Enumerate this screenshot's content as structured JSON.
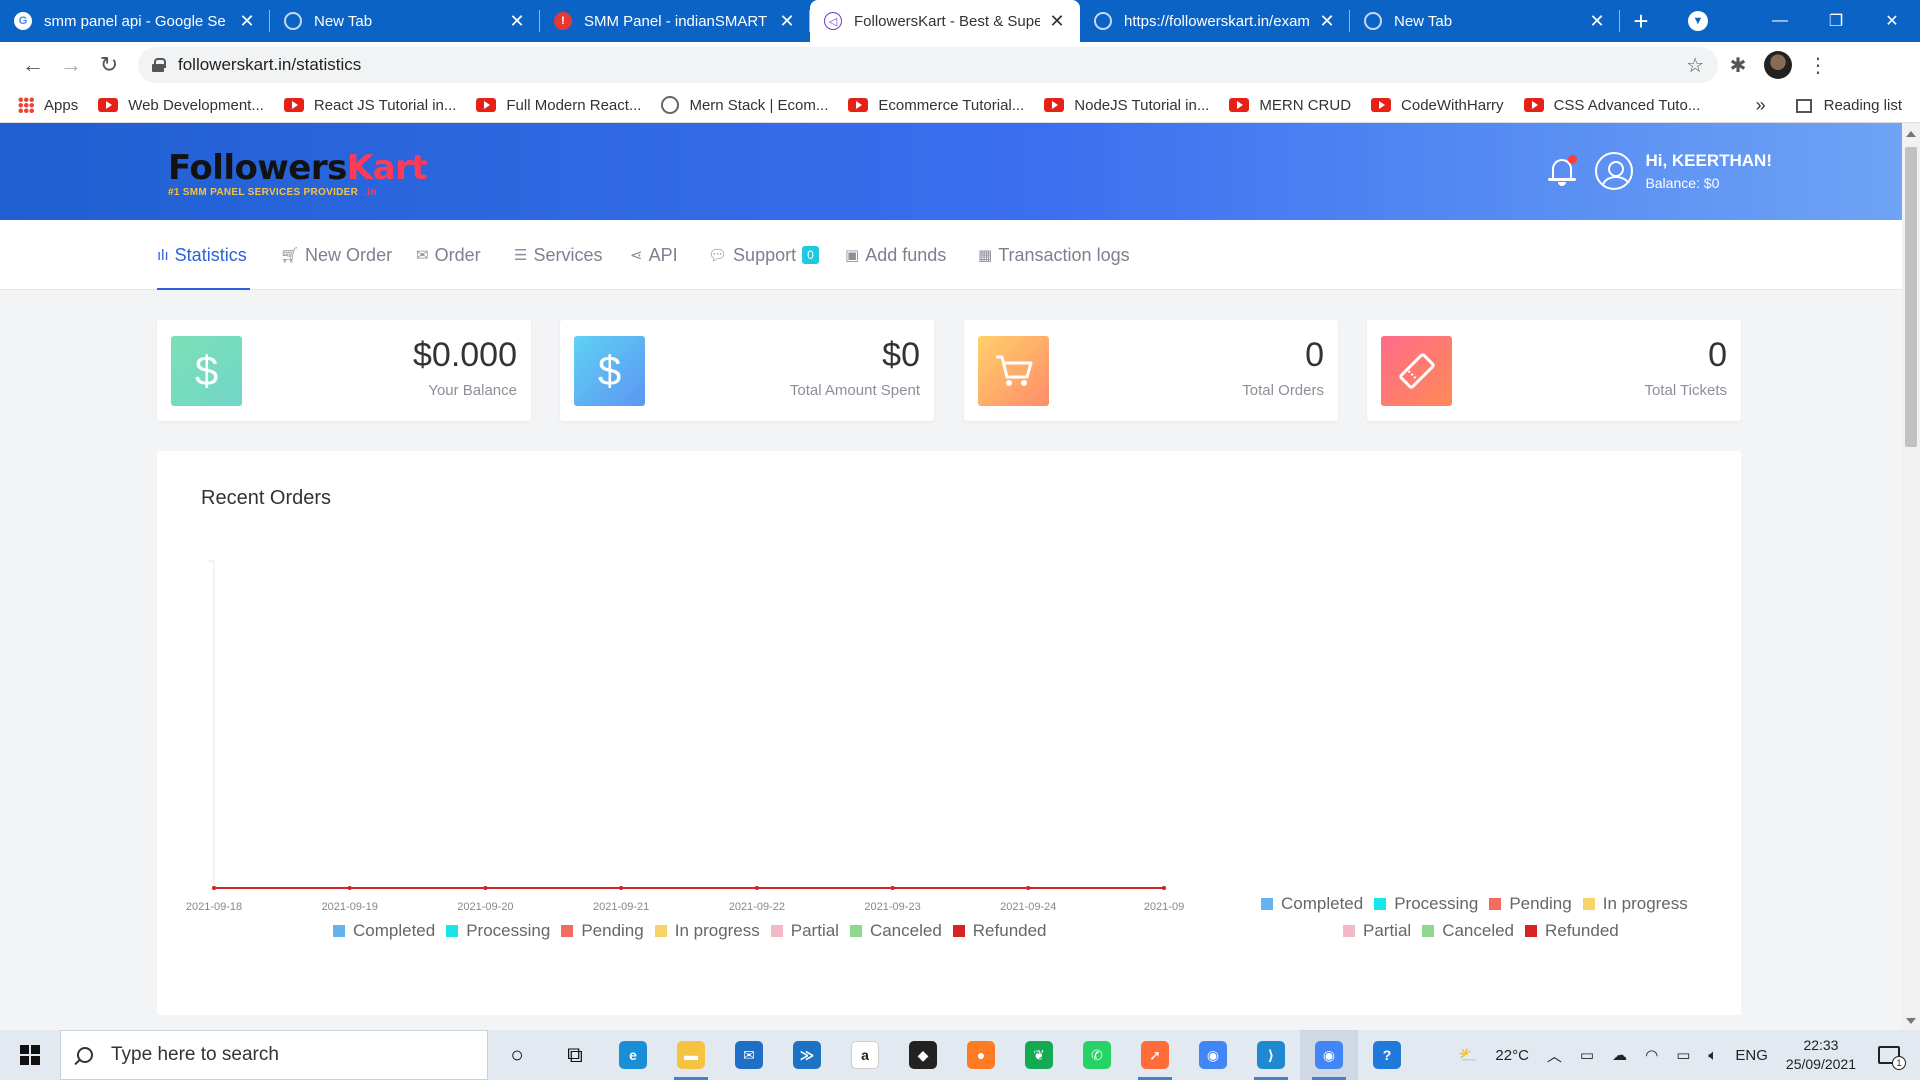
{
  "browser": {
    "tabs": [
      {
        "title": "smm panel api - Google Se",
        "favicon": "google-icon",
        "active": false
      },
      {
        "title": "New Tab",
        "favicon": "chrome-icon",
        "active": false
      },
      {
        "title": "SMM Panel - indianSMART",
        "favicon": "site-red-icon",
        "active": false
      },
      {
        "title": "FollowersKart - Best & Supe",
        "favicon": "followerskart-icon",
        "active": true
      },
      {
        "title": "https://followerskart.in/exam",
        "favicon": "globe-icon",
        "active": false
      },
      {
        "title": "New Tab",
        "favicon": "chrome-icon",
        "active": false
      }
    ],
    "url": "followerskart.in/statistics",
    "bookmarks": [
      {
        "label": "Apps",
        "icon": "apps-grid-icon"
      },
      {
        "label": "Web Development...",
        "icon": "youtube-icon"
      },
      {
        "label": "React JS Tutorial in...",
        "icon": "youtube-icon"
      },
      {
        "label": "Full Modern React...",
        "icon": "youtube-icon"
      },
      {
        "label": "Mern Stack | Ecom...",
        "icon": "globe-icon"
      },
      {
        "label": "Ecommerce Tutorial...",
        "icon": "youtube-icon"
      },
      {
        "label": "NodeJS Tutorial in...",
        "icon": "youtube-icon"
      },
      {
        "label": "MERN CRUD",
        "icon": "youtube-icon"
      },
      {
        "label": "CodeWithHarry",
        "icon": "youtube-icon"
      },
      {
        "label": "CSS Advanced Tuto...",
        "icon": "youtube-icon"
      }
    ],
    "reading_list": "Reading list"
  },
  "header": {
    "logo_main": "Followers",
    "logo_accent": "Kart",
    "logo_tagline": "#1 SMM PANEL SERVICES PROVIDER",
    "logo_domain": ".in",
    "greeting": "Hi, KEERTHAN!",
    "balance": "Balance: $0"
  },
  "menu": [
    {
      "label": "Statistics",
      "icon": "bar-chart-icon",
      "active": true
    },
    {
      "label": "New Order",
      "icon": "cart-icon",
      "active": false
    },
    {
      "label": "Order",
      "icon": "inbox-icon",
      "active": false
    },
    {
      "label": "Services",
      "icon": "list-icon",
      "active": false
    },
    {
      "label": "API",
      "icon": "share-icon",
      "active": false
    },
    {
      "label": "Support",
      "icon": "chat-icon",
      "active": false,
      "badge": "0"
    },
    {
      "label": "Add funds",
      "icon": "money-icon",
      "active": false
    },
    {
      "label": "Transaction logs",
      "icon": "calendar-icon",
      "active": false
    }
  ],
  "stats": [
    {
      "value": "$0.000",
      "label": "Your Balance",
      "icon": "dollar-icon"
    },
    {
      "value": "$0",
      "label": "Total Amount Spent",
      "icon": "dollar-icon"
    },
    {
      "value": "0",
      "label": "Total Orders",
      "icon": "cart-icon"
    },
    {
      "value": "0",
      "label": "Total Tickets",
      "icon": "ticket-icon"
    }
  ],
  "recent_orders": {
    "title": "Recent Orders",
    "legend2": [
      [
        "Completed",
        "Processing",
        "Pending",
        "In progress"
      ],
      [
        "Partial",
        "Canceled",
        "Refunded"
      ]
    ]
  },
  "chart_data": {
    "type": "line",
    "title": "Recent Orders",
    "x": [
      "2021-09-18",
      "2021-09-19",
      "2021-09-20",
      "2021-09-21",
      "2021-09-22",
      "2021-09-23",
      "2021-09-24",
      "2021-09"
    ],
    "series": [
      {
        "name": "Completed",
        "color": "#63b3ed",
        "values": [
          0,
          0,
          0,
          0,
          0,
          0,
          0,
          0
        ]
      },
      {
        "name": "Processing",
        "color": "#19e6e6",
        "values": [
          0,
          0,
          0,
          0,
          0,
          0,
          0,
          0
        ]
      },
      {
        "name": "Pending",
        "color": "#f46b5f",
        "values": [
          0,
          0,
          0,
          0,
          0,
          0,
          0,
          0
        ]
      },
      {
        "name": "In progress",
        "color": "#f7d46a",
        "values": [
          0,
          0,
          0,
          0,
          0,
          0,
          0,
          0
        ]
      },
      {
        "name": "Partial",
        "color": "#f4b9c8",
        "values": [
          0,
          0,
          0,
          0,
          0,
          0,
          0,
          0
        ]
      },
      {
        "name": "Canceled",
        "color": "#8fd68f",
        "values": [
          0,
          0,
          0,
          0,
          0,
          0,
          0,
          0
        ]
      },
      {
        "name": "Refunded",
        "color": "#d42424",
        "values": [
          0,
          0,
          0,
          0,
          0,
          0,
          0,
          0
        ]
      }
    ],
    "grid": false,
    "legend": "bottom"
  },
  "taskbar": {
    "search_placeholder": "Type here to search",
    "weather": "22°C",
    "language": "ENG",
    "time": "22:33",
    "date": "25/09/2021",
    "notifications": "1",
    "apps": [
      {
        "name": "cortana-icon"
      },
      {
        "name": "task-view-icon"
      },
      {
        "name": "edge-icon",
        "color": "#1a8ed6"
      },
      {
        "name": "file-explorer-icon",
        "color": "#f5c242"
      },
      {
        "name": "mail-icon",
        "color": "#1f6fc7"
      },
      {
        "name": "powershell-icon",
        "color": "#1c73c4"
      },
      {
        "name": "amazon-icon",
        "color": "#ffffff",
        "text": "a"
      },
      {
        "name": "dropbox-icon",
        "color": "#222222"
      },
      {
        "name": "firefox-icon",
        "color": "#ff7b22"
      },
      {
        "name": "mongodb-icon",
        "color": "#13aa52"
      },
      {
        "name": "whatsapp-icon",
        "color": "#25d366"
      },
      {
        "name": "postman-icon",
        "color": "#ff6c37"
      },
      {
        "name": "chrome-icon",
        "color": "#4285f4"
      },
      {
        "name": "vscode-icon",
        "color": "#1f8ad2"
      },
      {
        "name": "chrome-profile-icon",
        "color": "#4285f4"
      },
      {
        "name": "help-icon",
        "color": "#1f7ad9"
      }
    ]
  }
}
